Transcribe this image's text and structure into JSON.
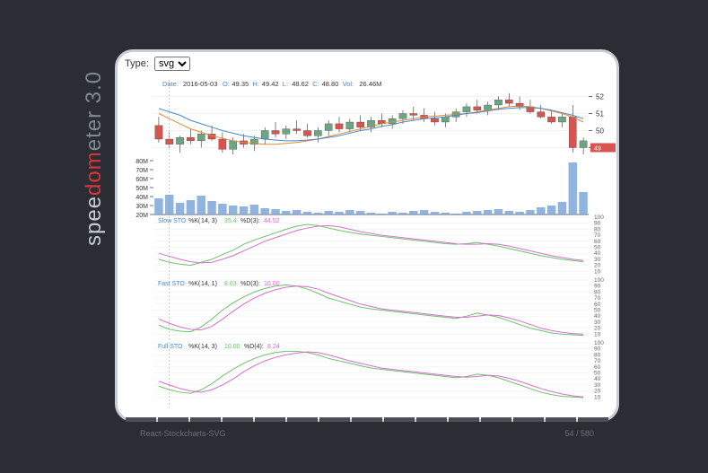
{
  "logo": {
    "p1": "spee",
    "p2": "dom",
    "p3": "eter 3.0"
  },
  "selector": {
    "label": "Type:",
    "value": "svg"
  },
  "tooltip": {
    "date_label": "Date:",
    "date": "2016-05-03",
    "o_label": "O:",
    "o": "49.35",
    "h_label": "H:",
    "h": "49.42",
    "l_label": "L:",
    "l": "48.62",
    "c_label": "C:",
    "c": "48.80",
    "v_label": "Vol:",
    "v": "26.46M"
  },
  "price_axis": [
    "49",
    "50",
    "51",
    "52"
  ],
  "volume_axis": [
    "20M",
    "30M",
    "40M",
    "50M",
    "60M",
    "70M",
    "80M"
  ],
  "sto_axis": [
    "10",
    "20",
    "30",
    "40",
    "50",
    "60",
    "70",
    "80",
    "90",
    "100"
  ],
  "sto_labels": {
    "slow": {
      "title": "Slow STO",
      "kparams": "%K(",
      "kv": "14, 3)",
      "kval": "35.4",
      "dparams": "%D(3):",
      "dval": "44.52"
    },
    "fast": {
      "title": "Fast STO",
      "kparams": "%K(",
      "kv": "14, 1)",
      "kval": "8.63",
      "dparams": "%D(3):",
      "dval": "10.00"
    },
    "full": {
      "title": "Full STO",
      "kparams": "%K(",
      "kv": "14, 3)",
      "kval": "10.00",
      "dparams": "%D(4):",
      "dval": "8.24"
    }
  },
  "footer": {
    "name": "React-Stockcharts-SVG",
    "progress": "54 / 580"
  },
  "chart_data": {
    "type": "candlestick",
    "title": "",
    "xlabel": "",
    "ylabel": "",
    "price_ylim": [
      48.5,
      52.5
    ],
    "candles": [
      {
        "o": 50.3,
        "h": 50.8,
        "l": 49.3,
        "c": 49.5
      },
      {
        "o": 49.5,
        "h": 49.9,
        "l": 49.0,
        "c": 49.2
      },
      {
        "o": 49.2,
        "h": 49.7,
        "l": 48.7,
        "c": 49.6
      },
      {
        "o": 49.6,
        "h": 50.1,
        "l": 49.2,
        "c": 49.4
      },
      {
        "o": 49.4,
        "h": 50.0,
        "l": 49.0,
        "c": 49.8
      },
      {
        "o": 49.8,
        "h": 50.3,
        "l": 49.4,
        "c": 49.5
      },
      {
        "o": 49.5,
        "h": 49.9,
        "l": 48.7,
        "c": 48.9
      },
      {
        "o": 48.9,
        "h": 49.6,
        "l": 48.6,
        "c": 49.4
      },
      {
        "o": 49.4,
        "h": 49.8,
        "l": 49.0,
        "c": 49.2
      },
      {
        "o": 49.2,
        "h": 49.7,
        "l": 48.8,
        "c": 49.5
      },
      {
        "o": 49.5,
        "h": 50.2,
        "l": 49.2,
        "c": 50.0
      },
      {
        "o": 50.0,
        "h": 50.5,
        "l": 49.6,
        "c": 49.8
      },
      {
        "o": 49.8,
        "h": 50.3,
        "l": 49.5,
        "c": 50.1
      },
      {
        "o": 50.1,
        "h": 50.6,
        "l": 49.8,
        "c": 50.0
      },
      {
        "o": 50.0,
        "h": 50.4,
        "l": 49.6,
        "c": 49.7
      },
      {
        "o": 49.7,
        "h": 50.2,
        "l": 49.3,
        "c": 50.0
      },
      {
        "o": 50.0,
        "h": 50.6,
        "l": 49.7,
        "c": 50.4
      },
      {
        "o": 50.4,
        "h": 50.8,
        "l": 49.9,
        "c": 50.1
      },
      {
        "o": 50.1,
        "h": 50.7,
        "l": 49.9,
        "c": 50.5
      },
      {
        "o": 50.5,
        "h": 50.9,
        "l": 50.0,
        "c": 50.2
      },
      {
        "o": 50.2,
        "h": 50.8,
        "l": 49.9,
        "c": 50.6
      },
      {
        "o": 50.6,
        "h": 51.0,
        "l": 50.2,
        "c": 50.4
      },
      {
        "o": 50.4,
        "h": 50.9,
        "l": 50.1,
        "c": 50.7
      },
      {
        "o": 50.7,
        "h": 51.2,
        "l": 50.4,
        "c": 51.0
      },
      {
        "o": 51.0,
        "h": 51.4,
        "l": 50.6,
        "c": 50.9
      },
      {
        "o": 50.9,
        "h": 51.3,
        "l": 50.5,
        "c": 50.7
      },
      {
        "o": 50.7,
        "h": 51.1,
        "l": 50.3,
        "c": 50.5
      },
      {
        "o": 50.5,
        "h": 51.0,
        "l": 50.2,
        "c": 50.8
      },
      {
        "o": 50.8,
        "h": 51.3,
        "l": 50.5,
        "c": 51.1
      },
      {
        "o": 51.1,
        "h": 51.6,
        "l": 50.8,
        "c": 51.4
      },
      {
        "o": 51.4,
        "h": 51.8,
        "l": 51.0,
        "c": 51.2
      },
      {
        "o": 51.2,
        "h": 51.7,
        "l": 50.9,
        "c": 51.5
      },
      {
        "o": 51.5,
        "h": 52.0,
        "l": 51.2,
        "c": 51.8
      },
      {
        "o": 51.8,
        "h": 52.2,
        "l": 51.4,
        "c": 51.6
      },
      {
        "o": 51.6,
        "h": 52.0,
        "l": 51.2,
        "c": 51.4
      },
      {
        "o": 51.4,
        "h": 51.8,
        "l": 51.0,
        "c": 51.1
      },
      {
        "o": 51.1,
        "h": 51.5,
        "l": 50.7,
        "c": 50.8
      },
      {
        "o": 50.8,
        "h": 51.2,
        "l": 50.4,
        "c": 50.5
      },
      {
        "o": 50.5,
        "h": 51.0,
        "l": 50.2,
        "c": 50.8
      },
      {
        "o": 50.8,
        "h": 51.5,
        "l": 48.7,
        "c": 49.0
      },
      {
        "o": 49.0,
        "h": 49.6,
        "l": 48.6,
        "c": 49.4
      }
    ],
    "ma_orange": [
      51.0,
      50.7,
      50.4,
      50.1,
      49.9,
      49.7,
      49.55,
      49.4,
      49.3,
      49.25,
      49.2,
      49.2,
      49.25,
      49.3,
      49.4,
      49.5,
      49.65,
      49.8,
      49.95,
      50.1,
      50.25,
      50.4,
      50.5,
      50.6,
      50.7,
      50.8,
      50.85,
      50.9,
      50.95,
      51.0,
      51.1,
      51.2,
      51.3,
      51.4,
      51.45,
      51.4,
      51.3,
      51.15,
      51.0,
      50.8,
      50.5
    ],
    "ma_blue": [
      51.3,
      51.1,
      50.9,
      50.6,
      50.4,
      50.2,
      50.0,
      49.85,
      49.7,
      49.6,
      49.5,
      49.45,
      49.4,
      49.4,
      49.45,
      49.5,
      49.6,
      49.7,
      49.85,
      50.0,
      50.1,
      50.25,
      50.35,
      50.5,
      50.6,
      50.7,
      50.75,
      50.8,
      50.9,
      51.0,
      51.05,
      51.15,
      51.25,
      51.3,
      51.35,
      51.35,
      51.3,
      51.2,
      51.05,
      50.9,
      50.7
    ],
    "volume": [
      38,
      42,
      33,
      36,
      41,
      35,
      32,
      30,
      29,
      31,
      27,
      26,
      24,
      25,
      23,
      22,
      24,
      23,
      25,
      24,
      22,
      21,
      23,
      22,
      24,
      25,
      23,
      22,
      21,
      23,
      24,
      25,
      26,
      24,
      23,
      25,
      28,
      30,
      34,
      78,
      45
    ],
    "volume_ylim": [
      20,
      80
    ],
    "sto_slow": {
      "k": [
        30,
        25,
        22,
        20,
        25,
        30,
        38,
        45,
        55,
        62,
        68,
        74,
        80,
        85,
        88,
        86,
        82,
        78,
        75,
        72,
        70,
        68,
        66,
        64,
        62,
        60,
        58,
        56,
        55,
        56,
        58,
        55,
        52,
        48,
        44,
        40,
        36,
        33,
        30,
        28,
        26
      ],
      "d": [
        40,
        35,
        30,
        26,
        24,
        25,
        30,
        36,
        44,
        52,
        60,
        66,
        72,
        78,
        82,
        85,
        86,
        84,
        80,
        76,
        73,
        70,
        68,
        66,
        64,
        62,
        60,
        58,
        56,
        55,
        55,
        56,
        55,
        52,
        48,
        44,
        40,
        36,
        33,
        30,
        28
      ]
    },
    "sto_fast": {
      "k": [
        25,
        18,
        15,
        14,
        22,
        35,
        50,
        62,
        72,
        80,
        86,
        90,
        92,
        90,
        85,
        78,
        70,
        65,
        60,
        55,
        52,
        50,
        48,
        46,
        44,
        42,
        40,
        38,
        36,
        40,
        45,
        42,
        38,
        32,
        26,
        20,
        16,
        12,
        10,
        9,
        8
      ],
      "d": [
        35,
        28,
        22,
        18,
        17,
        23,
        35,
        48,
        60,
        70,
        78,
        84,
        88,
        90,
        89,
        85,
        78,
        72,
        66,
        60,
        56,
        52,
        50,
        48,
        46,
        44,
        42,
        40,
        38,
        38,
        40,
        42,
        41,
        37,
        32,
        26,
        20,
        16,
        13,
        11,
        10
      ]
    },
    "sto_full": {
      "k": [
        28,
        22,
        18,
        16,
        22,
        32,
        45,
        56,
        66,
        74,
        80,
        84,
        86,
        86,
        84,
        80,
        74,
        70,
        66,
        62,
        58,
        56,
        54,
        52,
        50,
        48,
        46,
        44,
        42,
        44,
        48,
        46,
        42,
        36,
        30,
        24,
        18,
        14,
        11,
        10,
        9
      ],
      "d": [
        36,
        30,
        24,
        20,
        18,
        22,
        30,
        40,
        52,
        62,
        70,
        76,
        80,
        83,
        85,
        84,
        80,
        75,
        70,
        66,
        62,
        58,
        56,
        54,
        52,
        50,
        48,
        46,
        44,
        43,
        44,
        46,
        45,
        41,
        36,
        30,
        24,
        19,
        15,
        12,
        10
      ]
    }
  }
}
